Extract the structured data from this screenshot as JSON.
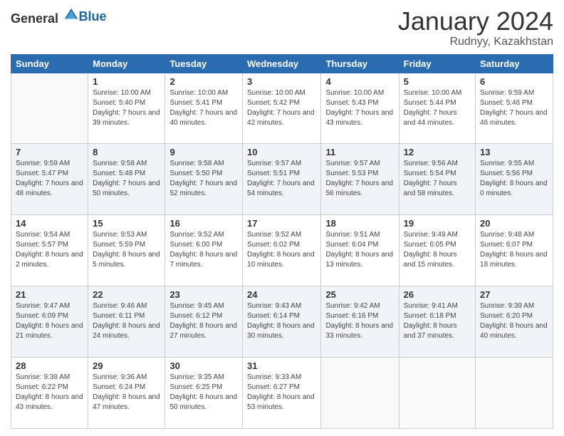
{
  "header": {
    "logo_general": "General",
    "logo_blue": "Blue",
    "month": "January 2024",
    "location": "Rudnyy, Kazakhstan"
  },
  "weekdays": [
    "Sunday",
    "Monday",
    "Tuesday",
    "Wednesday",
    "Thursday",
    "Friday",
    "Saturday"
  ],
  "weeks": [
    [
      {
        "day": "",
        "sunrise": "",
        "sunset": "",
        "daylight": ""
      },
      {
        "day": "1",
        "sunrise": "Sunrise: 10:00 AM",
        "sunset": "Sunset: 5:40 PM",
        "daylight": "Daylight: 7 hours and 39 minutes."
      },
      {
        "day": "2",
        "sunrise": "Sunrise: 10:00 AM",
        "sunset": "Sunset: 5:41 PM",
        "daylight": "Daylight: 7 hours and 40 minutes."
      },
      {
        "day": "3",
        "sunrise": "Sunrise: 10:00 AM",
        "sunset": "Sunset: 5:42 PM",
        "daylight": "Daylight: 7 hours and 42 minutes."
      },
      {
        "day": "4",
        "sunrise": "Sunrise: 10:00 AM",
        "sunset": "Sunset: 5:43 PM",
        "daylight": "Daylight: 7 hours and 43 minutes."
      },
      {
        "day": "5",
        "sunrise": "Sunrise: 10:00 AM",
        "sunset": "Sunset: 5:44 PM",
        "daylight": "Daylight: 7 hours and 44 minutes."
      },
      {
        "day": "6",
        "sunrise": "Sunrise: 9:59 AM",
        "sunset": "Sunset: 5:46 PM",
        "daylight": "Daylight: 7 hours and 46 minutes."
      }
    ],
    [
      {
        "day": "7",
        "sunrise": "Sunrise: 9:59 AM",
        "sunset": "Sunset: 5:47 PM",
        "daylight": "Daylight: 7 hours and 48 minutes."
      },
      {
        "day": "8",
        "sunrise": "Sunrise: 9:58 AM",
        "sunset": "Sunset: 5:48 PM",
        "daylight": "Daylight: 7 hours and 50 minutes."
      },
      {
        "day": "9",
        "sunrise": "Sunrise: 9:58 AM",
        "sunset": "Sunset: 5:50 PM",
        "daylight": "Daylight: 7 hours and 52 minutes."
      },
      {
        "day": "10",
        "sunrise": "Sunrise: 9:57 AM",
        "sunset": "Sunset: 5:51 PM",
        "daylight": "Daylight: 7 hours and 54 minutes."
      },
      {
        "day": "11",
        "sunrise": "Sunrise: 9:57 AM",
        "sunset": "Sunset: 5:53 PM",
        "daylight": "Daylight: 7 hours and 56 minutes."
      },
      {
        "day": "12",
        "sunrise": "Sunrise: 9:56 AM",
        "sunset": "Sunset: 5:54 PM",
        "daylight": "Daylight: 7 hours and 58 minutes."
      },
      {
        "day": "13",
        "sunrise": "Sunrise: 9:55 AM",
        "sunset": "Sunset: 5:56 PM",
        "daylight": "Daylight: 8 hours and 0 minutes."
      }
    ],
    [
      {
        "day": "14",
        "sunrise": "Sunrise: 9:54 AM",
        "sunset": "Sunset: 5:57 PM",
        "daylight": "Daylight: 8 hours and 2 minutes."
      },
      {
        "day": "15",
        "sunrise": "Sunrise: 9:53 AM",
        "sunset": "Sunset: 5:59 PM",
        "daylight": "Daylight: 8 hours and 5 minutes."
      },
      {
        "day": "16",
        "sunrise": "Sunrise: 9:52 AM",
        "sunset": "Sunset: 6:00 PM",
        "daylight": "Daylight: 8 hours and 7 minutes."
      },
      {
        "day": "17",
        "sunrise": "Sunrise: 9:52 AM",
        "sunset": "Sunset: 6:02 PM",
        "daylight": "Daylight: 8 hours and 10 minutes."
      },
      {
        "day": "18",
        "sunrise": "Sunrise: 9:51 AM",
        "sunset": "Sunset: 6:04 PM",
        "daylight": "Daylight: 8 hours and 13 minutes."
      },
      {
        "day": "19",
        "sunrise": "Sunrise: 9:49 AM",
        "sunset": "Sunset: 6:05 PM",
        "daylight": "Daylight: 8 hours and 15 minutes."
      },
      {
        "day": "20",
        "sunrise": "Sunrise: 9:48 AM",
        "sunset": "Sunset: 6:07 PM",
        "daylight": "Daylight: 8 hours and 18 minutes."
      }
    ],
    [
      {
        "day": "21",
        "sunrise": "Sunrise: 9:47 AM",
        "sunset": "Sunset: 6:09 PM",
        "daylight": "Daylight: 8 hours and 21 minutes."
      },
      {
        "day": "22",
        "sunrise": "Sunrise: 9:46 AM",
        "sunset": "Sunset: 6:11 PM",
        "daylight": "Daylight: 8 hours and 24 minutes."
      },
      {
        "day": "23",
        "sunrise": "Sunrise: 9:45 AM",
        "sunset": "Sunset: 6:12 PM",
        "daylight": "Daylight: 8 hours and 27 minutes."
      },
      {
        "day": "24",
        "sunrise": "Sunrise: 9:43 AM",
        "sunset": "Sunset: 6:14 PM",
        "daylight": "Daylight: 8 hours and 30 minutes."
      },
      {
        "day": "25",
        "sunrise": "Sunrise: 9:42 AM",
        "sunset": "Sunset: 6:16 PM",
        "daylight": "Daylight: 8 hours and 33 minutes."
      },
      {
        "day": "26",
        "sunrise": "Sunrise: 9:41 AM",
        "sunset": "Sunset: 6:18 PM",
        "daylight": "Daylight: 8 hours and 37 minutes."
      },
      {
        "day": "27",
        "sunrise": "Sunrise: 9:39 AM",
        "sunset": "Sunset: 6:20 PM",
        "daylight": "Daylight: 8 hours and 40 minutes."
      }
    ],
    [
      {
        "day": "28",
        "sunrise": "Sunrise: 9:38 AM",
        "sunset": "Sunset: 6:22 PM",
        "daylight": "Daylight: 8 hours and 43 minutes."
      },
      {
        "day": "29",
        "sunrise": "Sunrise: 9:36 AM",
        "sunset": "Sunset: 6:24 PM",
        "daylight": "Daylight: 8 hours and 47 minutes."
      },
      {
        "day": "30",
        "sunrise": "Sunrise: 9:35 AM",
        "sunset": "Sunset: 6:25 PM",
        "daylight": "Daylight: 8 hours and 50 minutes."
      },
      {
        "day": "31",
        "sunrise": "Sunrise: 9:33 AM",
        "sunset": "Sunset: 6:27 PM",
        "daylight": "Daylight: 8 hours and 53 minutes."
      },
      {
        "day": "",
        "sunrise": "",
        "sunset": "",
        "daylight": ""
      },
      {
        "day": "",
        "sunrise": "",
        "sunset": "",
        "daylight": ""
      },
      {
        "day": "",
        "sunrise": "",
        "sunset": "",
        "daylight": ""
      }
    ]
  ]
}
